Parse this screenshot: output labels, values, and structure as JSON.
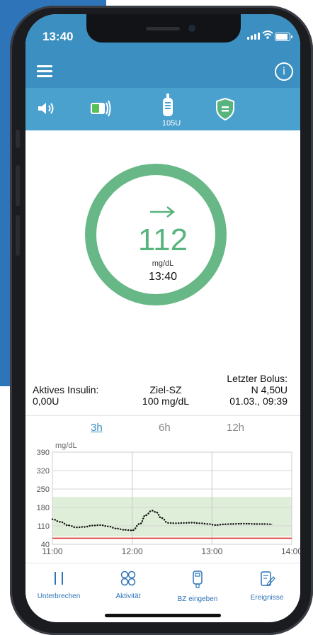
{
  "status_bar": {
    "time": "13:40"
  },
  "pump": {
    "reservoir_units": "105U"
  },
  "reading": {
    "trend": "steady",
    "value": "112",
    "unit": "mg/dL",
    "time": "13:40"
  },
  "info": {
    "active_insulin_label": "Aktives Insulin:",
    "active_insulin_value": "0,00U",
    "target_label": "Ziel-SZ",
    "target_value": "100 mg/dL",
    "last_bolus_label": "Letzter Bolus:",
    "last_bolus_amount": "N 4,50U",
    "last_bolus_time": "01.03., 09:39"
  },
  "range_tabs": [
    {
      "label": "3h",
      "active": true
    },
    {
      "label": "6h",
      "active": false
    },
    {
      "label": "12h",
      "active": false
    }
  ],
  "chart_data": {
    "type": "line",
    "ylabel": "mg/dL",
    "yticks": [
      390,
      320,
      250,
      180,
      110,
      40
    ],
    "xticks": [
      "11:00",
      "12:00",
      "13:00",
      "14:00"
    ],
    "ylim": [
      40,
      390
    ],
    "xlim": [
      "11:00",
      "14:00"
    ],
    "target_band": [
      70,
      220
    ],
    "low_threshold": 63,
    "grid": true,
    "series": [
      {
        "x": [
          "11:00",
          "11:06",
          "11:12",
          "11:18",
          "11:24",
          "11:30",
          "11:36",
          "11:42",
          "11:48",
          "11:54",
          "12:00",
          "12:06",
          "12:10",
          "12:15",
          "12:18",
          "12:22",
          "12:27",
          "12:33",
          "12:39",
          "12:45",
          "12:51",
          "12:57",
          "13:03",
          "13:09",
          "13:15",
          "13:21",
          "13:27",
          "13:33",
          "13:39",
          "13:45"
        ],
        "y": [
          135,
          125,
          112,
          104,
          106,
          111,
          113,
          108,
          100,
          95,
          93,
          118,
          150,
          168,
          162,
          140,
          121,
          120,
          121,
          122,
          120,
          117,
          113,
          116,
          117,
          118,
          118,
          117,
          117,
          116
        ]
      }
    ],
    "colors": {
      "line": "#111111",
      "band": "#dfeed8",
      "low_line": "#d9312b"
    }
  },
  "nav": [
    {
      "label": "Unterbrechen",
      "icon": "pause-icon"
    },
    {
      "label": "Aktivität",
      "icon": "activity-icon"
    },
    {
      "label": "BZ eingeben",
      "icon": "meter-icon"
    },
    {
      "label": "Ereignisse",
      "icon": "events-icon"
    }
  ],
  "colors": {
    "header": "#3b8fc1",
    "statusrow": "#4aa1cd",
    "accent": "#58b47e",
    "nav": "#2d74b8"
  }
}
